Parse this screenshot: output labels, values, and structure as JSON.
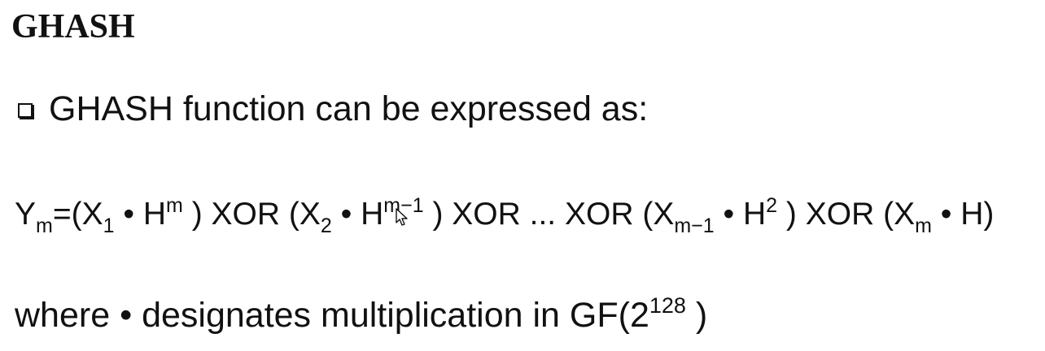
{
  "slide": {
    "title": "GHASH",
    "bullet_text": "GHASH function can be expressed as:",
    "formula": {
      "lhs_base": "Y",
      "lhs_sub": "m",
      "equals_open": "=(",
      "t1_x": "X",
      "t1_x_sub": "1",
      "t1_dot_h": " • H",
      "t1_h_sup": "m",
      "t1_close_xor": " ) XOR (",
      "t2_x": "X",
      "t2_x_sub": "2",
      "t2_dot_h": " • H",
      "t2_h_sup": "m−1",
      "t2_close_xor": " ) XOR ... XOR (",
      "t3_x": "X",
      "t3_x_sub": "m−1",
      "t3_dot_h": " • H",
      "t3_h_sup": "2",
      "t3_close_xor": " ) XOR (",
      "t4_x": "X",
      "t4_x_sub": "m",
      "t4_tail": " • H)"
    },
    "where": {
      "prefix": "where • designates multiplication in GF(2",
      "exponent": "128",
      "suffix": " )"
    },
    "icons": {
      "cursor": "mouse-pointer-icon"
    }
  }
}
